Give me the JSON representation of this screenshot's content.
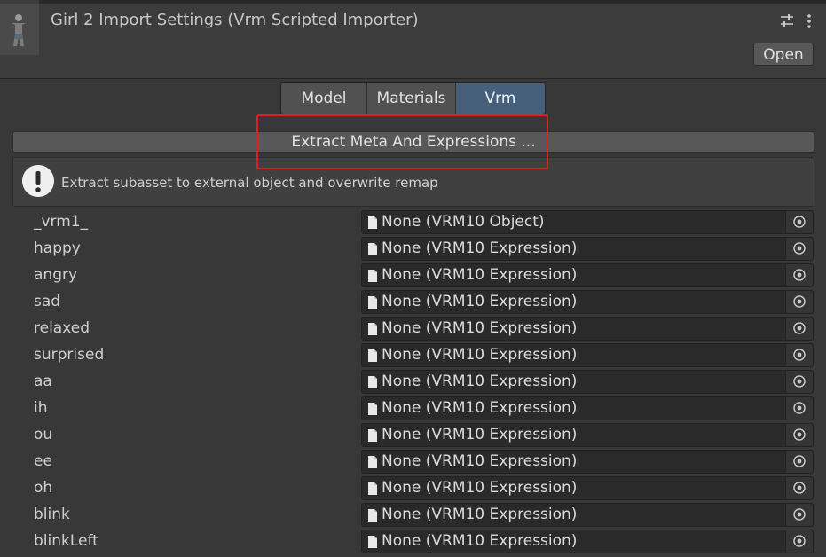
{
  "header": {
    "title": "Girl 2 Import Settings (Vrm Scripted Importer)",
    "open_label": "Open",
    "icons": [
      "model-thumbnail-icon",
      "settings-sliders-icon",
      "more-vert-icon"
    ]
  },
  "tabs": [
    {
      "label": "Model",
      "active": false
    },
    {
      "label": "Materials",
      "active": false
    },
    {
      "label": "Vrm",
      "active": true
    }
  ],
  "extract_button": {
    "label": "Extract Meta And Expressions ..."
  },
  "help": {
    "icon": "warning-icon",
    "message": "Extract subasset to external object and overwrite remap"
  },
  "rows": [
    {
      "label": "_vrm1_",
      "value": "None (VRM10 Object)"
    },
    {
      "label": "happy",
      "value": "None (VRM10 Expression)"
    },
    {
      "label": "angry",
      "value": "None (VRM10 Expression)"
    },
    {
      "label": "sad",
      "value": "None (VRM10 Expression)"
    },
    {
      "label": "relaxed",
      "value": "None (VRM10 Expression)"
    },
    {
      "label": "surprised",
      "value": "None (VRM10 Expression)"
    },
    {
      "label": "aa",
      "value": "None (VRM10 Expression)"
    },
    {
      "label": "ih",
      "value": "None (VRM10 Expression)"
    },
    {
      "label": "ou",
      "value": "None (VRM10 Expression)"
    },
    {
      "label": "ee",
      "value": "None (VRM10 Expression)"
    },
    {
      "label": "oh",
      "value": "None (VRM10 Expression)"
    },
    {
      "label": "blink",
      "value": "None (VRM10 Expression)"
    },
    {
      "label": "blinkLeft",
      "value": "None (VRM10 Expression)"
    }
  ],
  "colors": {
    "background": "#383838",
    "active_tab": "#46607c",
    "highlight_box": "#e02020"
  }
}
